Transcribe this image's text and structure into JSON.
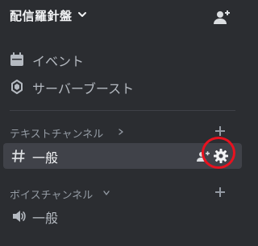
{
  "header": {
    "server_name": "配信羅針盤"
  },
  "menu": [
    {
      "label": "イベント",
      "icon": "calendar-icon"
    },
    {
      "label": "サーバーブースト",
      "icon": "boost-icon"
    }
  ],
  "categories": [
    {
      "label": "テキストチャンネル",
      "chevron": "chevron-right-icon",
      "channels": [
        {
          "label": "一般",
          "type": "text",
          "icon": "hash-icon",
          "selected": true
        }
      ]
    },
    {
      "label": "ボイスチャンネル",
      "chevron": "chevron-down-icon",
      "channels": [
        {
          "label": "一般",
          "type": "voice",
          "icon": "speaker-icon",
          "selected": false
        }
      ]
    }
  ],
  "colors": {
    "background": "#2b2d31",
    "selected_channel": "#404249",
    "highlight": "#e8121f",
    "muted_text": "#949ba4"
  }
}
